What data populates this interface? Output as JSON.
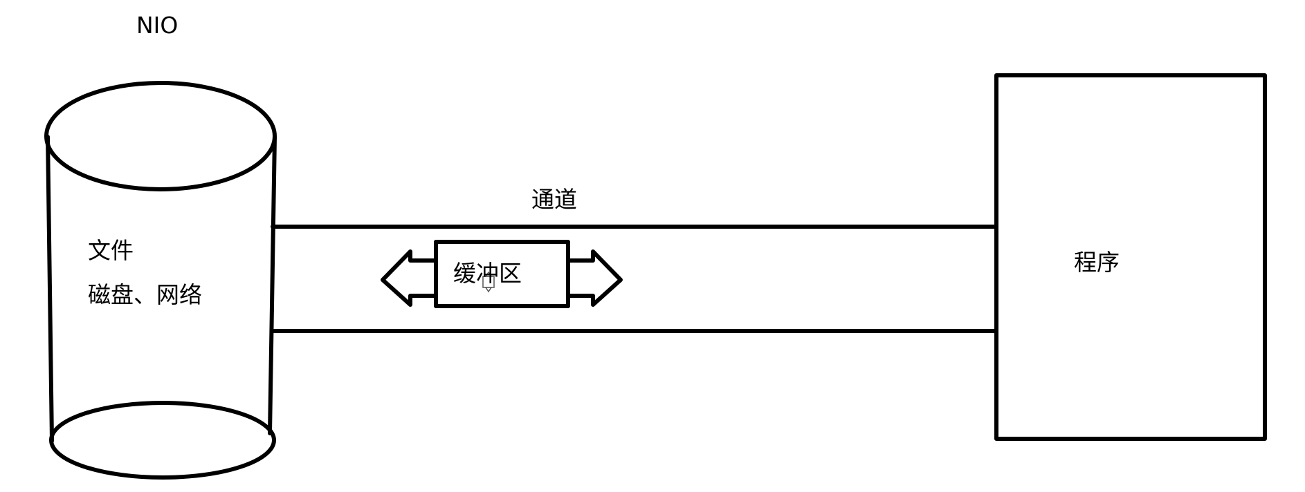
{
  "title": "NIO",
  "storage": {
    "line1": "文件",
    "line2": "磁盘、网络"
  },
  "channel": {
    "label": "通道"
  },
  "buffer": {
    "label": "缓冲区"
  },
  "program": {
    "label": "程序"
  },
  "colors": {
    "stroke": "#000000",
    "background": "#ffffff"
  }
}
